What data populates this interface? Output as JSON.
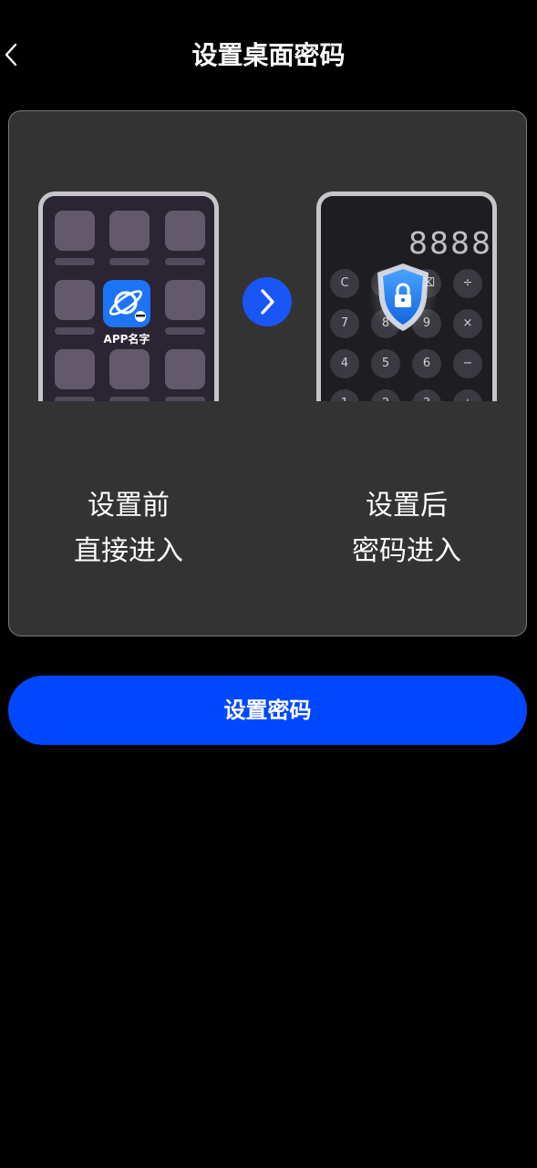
{
  "header": {
    "title": "设置桌面密码",
    "back_icon": "chevron-left-icon"
  },
  "illustration": {
    "before": {
      "app_name": "APP名字",
      "caption_line1": "设置前",
      "caption_line2": "直接进入"
    },
    "after": {
      "display": "8888",
      "keys": [
        "C",
        "%",
        "⌫",
        "÷",
        "7",
        "8",
        "9",
        "×",
        "4",
        "5",
        "6",
        "−",
        "1",
        "2",
        "3",
        "+"
      ],
      "caption_line1": "设置后",
      "caption_line2": "密码进入"
    },
    "arrow_icon": "chevron-right-icon"
  },
  "actions": {
    "set_password_label": "设置密码"
  },
  "colors": {
    "background": "#000000",
    "card": "#333333",
    "primary": "#0048ff",
    "arrow": "#1a55f5"
  }
}
